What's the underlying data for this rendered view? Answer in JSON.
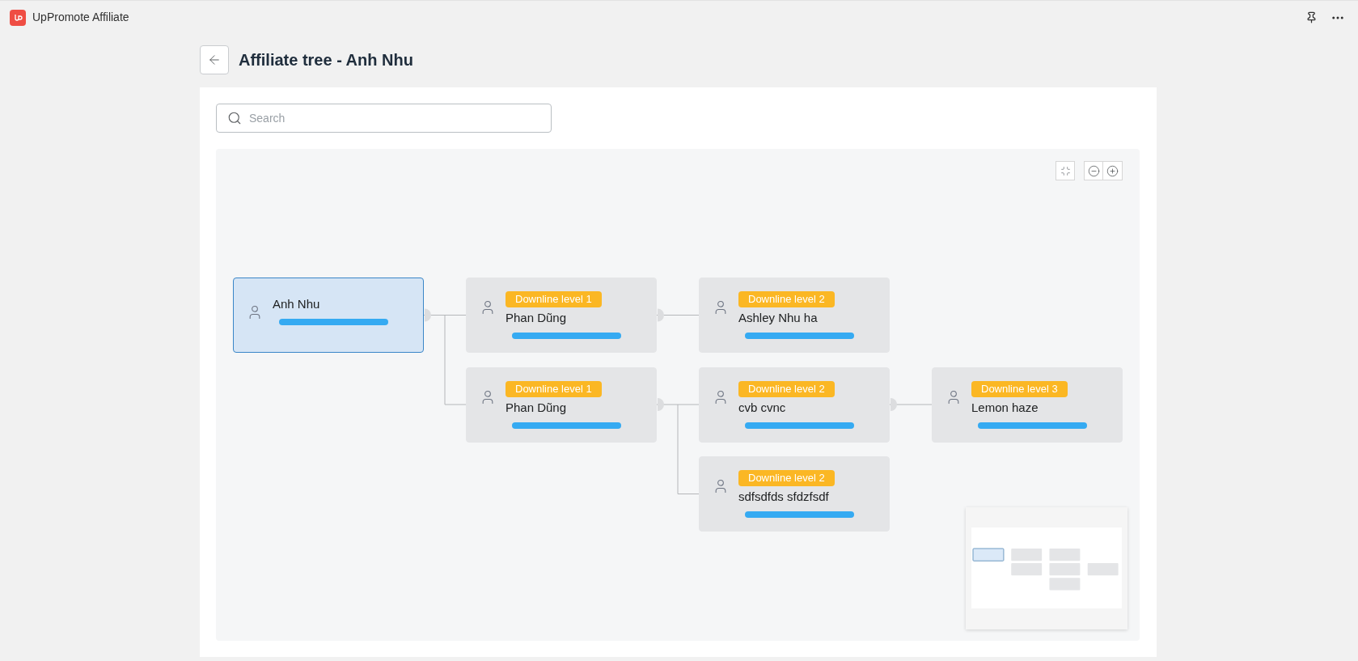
{
  "app": {
    "title": "UpPromote Affiliate"
  },
  "header": {
    "title": "Affiliate tree - Anh Nhu"
  },
  "search": {
    "placeholder": "Search"
  },
  "tree": {
    "name": "Anh Nhu",
    "email_redacted": true,
    "selected": true,
    "children": [
      {
        "badge": "Downline level 1",
        "name": "Phan Dũng",
        "email_redacted": true,
        "selected": false,
        "children": [
          {
            "badge": "Downline level 2",
            "name": "Ashley Nhu ha",
            "email_redacted": true,
            "selected": false
          }
        ]
      },
      {
        "badge": "Downline level 1",
        "name": "Phan Dũng",
        "email_redacted": true,
        "selected": false,
        "children": [
          {
            "badge": "Downline level 2",
            "name": "cvb cvnc",
            "email_redacted": true,
            "selected": false,
            "children": [
              {
                "badge": "Downline level 3",
                "name": "Lemon haze",
                "email_redacted": true,
                "selected": false
              }
            ]
          },
          {
            "badge": "Downline level 2",
            "name": "sdfsdfds sfdzfsdf",
            "email_redacted": true,
            "selected": false
          }
        ]
      }
    ]
  }
}
